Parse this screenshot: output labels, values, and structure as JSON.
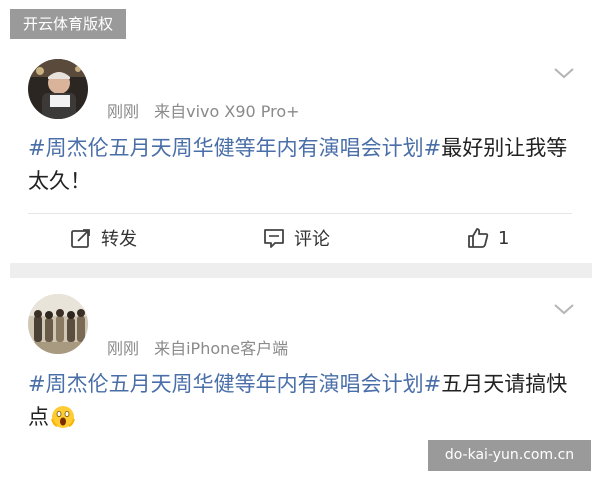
{
  "watermarks": {
    "top": "开云体育版权",
    "bottom": "do-kai-yun.com.cn"
  },
  "posts": [
    {
      "time": "刚刚",
      "source": "来自vivo X90 Pro+",
      "hashtag": "#周杰伦五月天周华健等年内有演唱会计划#",
      "text": "最好别让我等太久！",
      "actions": {
        "repost_label": "转发",
        "comment_label": "评论",
        "like_count": "1"
      }
    },
    {
      "time": "刚刚",
      "source": "来自iPhone客户端",
      "hashtag": "#周杰伦五月天周华健等年内有演唱会计划#",
      "text": "五月天请搞快点",
      "emoji": "scream-emoji"
    }
  ],
  "colors": {
    "hashtag": "#4a6fa8",
    "meta": "#8a8a8a",
    "separator": "#eeeeee"
  }
}
